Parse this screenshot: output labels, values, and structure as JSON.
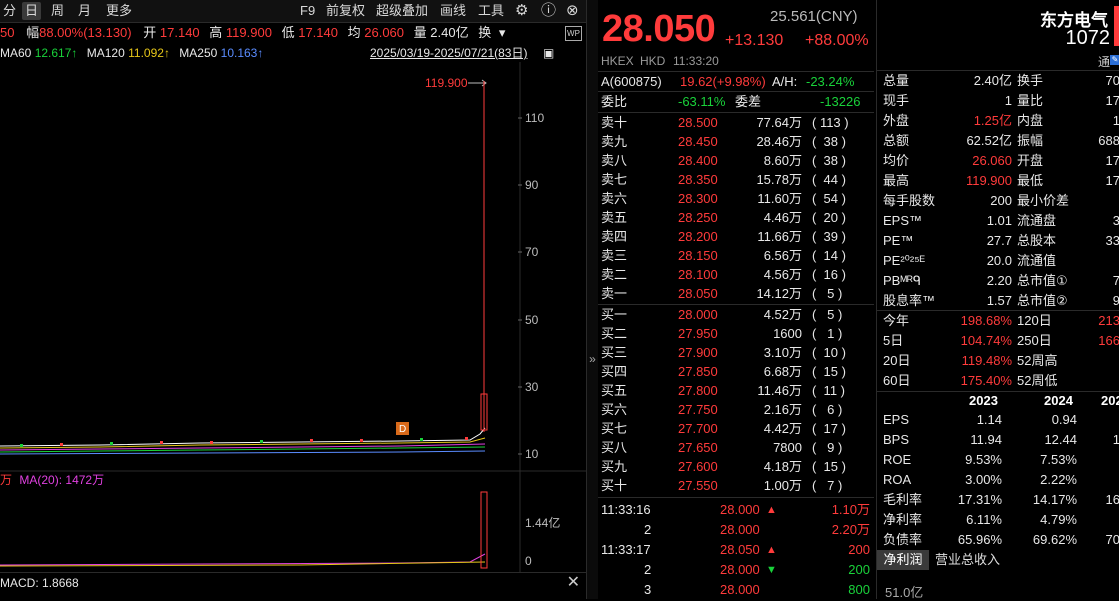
{
  "toolbar": {
    "items": [
      "分",
      "日",
      "周",
      "月",
      "更多"
    ],
    "right_items": [
      "F9",
      "前复权",
      "超级叠加",
      "画线",
      "工具"
    ]
  },
  "info_row": {
    "prev_fragment": "50",
    "fu_label": "幅",
    "fu_value": "88.00%(13.130)",
    "kai_label": "开",
    "kai_value": "17.140",
    "gao_label": "高",
    "gao_value": "119.900",
    "di_label": "低",
    "di_value": "17.140",
    "jun_label": "均",
    "jun_value": "26.060",
    "liang_label": "量",
    "liang_value": "2.40亿",
    "huan_label": "换"
  },
  "ma_row": {
    "ma60_label": "MA60",
    "ma60_value": "12.617↑",
    "ma120_label": "MA120",
    "ma120_value": "11.092↑",
    "ma250_label": "MA250",
    "ma250_value": "10.163↑",
    "date_range": "2025/03/19-2025/07/21(83日)"
  },
  "chart": {
    "y_ticks": [
      "110",
      "90",
      "70",
      "50",
      "30",
      "10"
    ],
    "high_label": "119.900",
    "marker_label": "D",
    "vol_tick": "1.44亿",
    "vol_zero": "0"
  },
  "vol_row": {
    "prefix": "万",
    "ma_label": "MA(20):",
    "ma_value": "1472万"
  },
  "macd_row": {
    "label": "MACD:",
    "value": "1.8668"
  },
  "quote": {
    "price": "28.050",
    "cny_price": "25.561(CNY)",
    "change": "+13.130",
    "change_pct": "+88.00%",
    "hkex": "HKEX",
    "hkd": "HKD",
    "time": "11:33:20",
    "a_code": "A(600875)",
    "a_price": "19.62(+9.98%)",
    "ah_label": "A/H:",
    "ah_value": "-23.24%",
    "weibi_label": "委比",
    "weibi_value": "-63.11%",
    "weicha_label": "委差",
    "weicha_value": "-13226",
    "asks": [
      {
        "label": "卖十",
        "price": "28.500",
        "vol": "77.64万",
        "cnt": "( 113 )"
      },
      {
        "label": "卖九",
        "price": "28.450",
        "vol": "28.46万",
        "cnt": "(  38 )"
      },
      {
        "label": "卖八",
        "price": "28.400",
        "vol": "8.60万",
        "cnt": "(  38 )"
      },
      {
        "label": "卖七",
        "price": "28.350",
        "vol": "15.78万",
        "cnt": "(  44 )"
      },
      {
        "label": "卖六",
        "price": "28.300",
        "vol": "11.60万",
        "cnt": "(  54 )"
      },
      {
        "label": "卖五",
        "price": "28.250",
        "vol": "4.46万",
        "cnt": "(  20 )"
      },
      {
        "label": "卖四",
        "price": "28.200",
        "vol": "11.66万",
        "cnt": "(  39 )"
      },
      {
        "label": "卖三",
        "price": "28.150",
        "vol": "6.56万",
        "cnt": "(  14 )"
      },
      {
        "label": "卖二",
        "price": "28.100",
        "vol": "4.56万",
        "cnt": "(  16 )"
      },
      {
        "label": "卖一",
        "price": "28.050",
        "vol": "14.12万",
        "cnt": "(   5 )"
      }
    ],
    "bids": [
      {
        "label": "买一",
        "price": "28.000",
        "vol": "4.52万",
        "cnt": "(   5 )"
      },
      {
        "label": "买二",
        "price": "27.950",
        "vol": "1600",
        "cnt": "(   1 )"
      },
      {
        "label": "买三",
        "price": "27.900",
        "vol": "3.10万",
        "cnt": "(  10 )"
      },
      {
        "label": "买四",
        "price": "27.850",
        "vol": "6.68万",
        "cnt": "(  15 )"
      },
      {
        "label": "买五",
        "price": "27.800",
        "vol": "11.46万",
        "cnt": "(  11 )"
      },
      {
        "label": "买六",
        "price": "27.750",
        "vol": "2.16万",
        "cnt": "(   6 )"
      },
      {
        "label": "买七",
        "price": "27.700",
        "vol": "4.42万",
        "cnt": "(  17 )"
      },
      {
        "label": "买八",
        "price": "27.650",
        "vol": "7800",
        "cnt": "(   9 )"
      },
      {
        "label": "买九",
        "price": "27.600",
        "vol": "4.18万",
        "cnt": "(  15 )"
      },
      {
        "label": "买十",
        "price": "27.550",
        "vol": "1.00万",
        "cnt": "(   7 )"
      }
    ],
    "ticks": [
      {
        "time": "11:33:16",
        "seq": "",
        "price": "28.000",
        "dir": "up",
        "vol": "1.10万",
        "vcolor": "red"
      },
      {
        "time": "",
        "seq": "2",
        "price": "28.000",
        "dir": "",
        "vol": "2.20万",
        "vcolor": "red"
      },
      {
        "time": "11:33:17",
        "seq": "",
        "price": "28.050",
        "dir": "up",
        "vol": "200",
        "vcolor": "red"
      },
      {
        "time": "",
        "seq": "2",
        "price": "28.000",
        "dir": "down",
        "vol": "200",
        "vcolor": "green"
      },
      {
        "time": "",
        "seq": "3",
        "price": "28.000",
        "dir": "",
        "vol": "800",
        "vcolor": "green"
      }
    ]
  },
  "stats": {
    "company": "东方电气",
    "code": "1072",
    "tong": "通",
    "rows": [
      {
        "l1": "总量",
        "v1": "2.40亿",
        "c1": "white",
        "l2": "换手",
        "v2": "70"
      },
      {
        "l1": "现手",
        "v1": "1",
        "c1": "white",
        "l2": "量比",
        "v2": "17"
      },
      {
        "l1": "外盘",
        "v1": "1.25亿",
        "c1": "red",
        "l2": "内盘",
        "v2": "1"
      },
      {
        "l1": "总额",
        "v1": "62.52亿",
        "c1": "white",
        "l2": "振幅",
        "v2": "688"
      },
      {
        "l1": "均价",
        "v1": "26.060",
        "c1": "red",
        "l2": "开盘",
        "v2": "17"
      },
      {
        "l1": "最高",
        "v1": "119.900",
        "c1": "red",
        "l2": "最低",
        "v2": "17"
      },
      {
        "l1": "每手股数",
        "v1": "200",
        "c1": "white",
        "l2": "最小价差",
        "v2": ""
      },
      {
        "l1": "EPS™",
        "v1": "1.01",
        "c1": "white",
        "l2": "流通盘",
        "v2": "3"
      },
      {
        "l1": "PE™",
        "v1": "27.7",
        "c1": "white",
        "l2": "总股本",
        "v2": "33"
      },
      {
        "l1": "PE²⁰²⁵ᴱ",
        "v1": "20.0",
        "c1": "white",
        "l2": "流通值",
        "v2": ""
      },
      {
        "l1": "PBᴹᴿᑫ",
        "v1": "2.20",
        "c1": "white",
        "l2": "总市值①",
        "v2": "7"
      },
      {
        "l1": "股息率™",
        "v1": "1.57",
        "c1": "white",
        "l2": "总市值②",
        "v2": "9"
      }
    ],
    "perf": [
      {
        "l1": "今年",
        "v1": "198.68%",
        "l2": "120日",
        "v2": "213"
      },
      {
        "l1": "5日",
        "v1": "104.74%",
        "l2": "250日",
        "v2": "166"
      },
      {
        "l1": "20日",
        "v1": "119.48%",
        "l2": "52周高",
        "v2": ""
      },
      {
        "l1": "60日",
        "v1": "175.40%",
        "l2": "52周低",
        "v2": ""
      }
    ],
    "fin_years": [
      "2023",
      "2024",
      "202"
    ],
    "fin_rows": [
      {
        "label": "EPS",
        "a": "1.14",
        "b": "0.94",
        "c": ""
      },
      {
        "label": "BPS",
        "a": "11.94",
        "b": "12.44",
        "c": "1"
      },
      {
        "label": "ROE",
        "a": "9.53%",
        "b": "7.53%",
        "c": ""
      },
      {
        "label": "ROA",
        "a": "3.00%",
        "b": "2.22%",
        "c": ""
      },
      {
        "label": "毛利率",
        "a": "17.31%",
        "b": "14.17%",
        "c": "16"
      },
      {
        "label": "净利率",
        "a": "6.11%",
        "b": "4.79%",
        "c": ""
      },
      {
        "label": "负债率",
        "a": "65.96%",
        "b": "69.62%",
        "c": "70"
      }
    ],
    "tabs": [
      "净利润",
      "营业总收入"
    ],
    "bottom_value": "51.0亿"
  }
}
